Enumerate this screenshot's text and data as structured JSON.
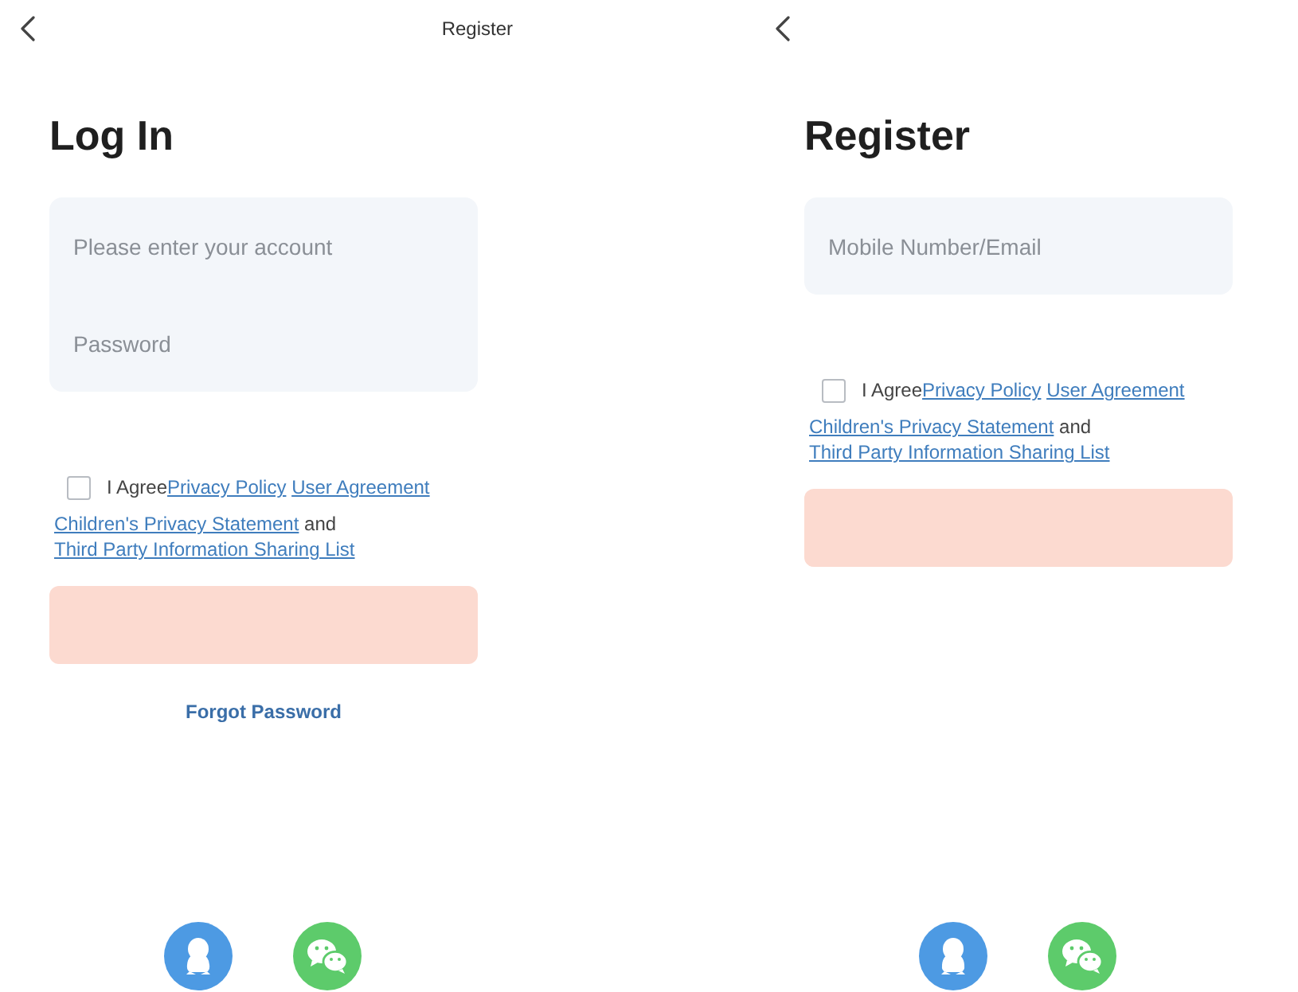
{
  "screens": [
    {
      "header_link": "Register",
      "title": "Log In",
      "fields": [
        {
          "placeholder": "Please enter your account"
        },
        {
          "placeholder": "Password"
        }
      ],
      "agreement": {
        "checked": false,
        "lines": [
          [
            {
              "kind": "text",
              "text": "I Agree"
            },
            {
              "kind": "link",
              "text": "Privacy Policy"
            },
            {
              "kind": "link",
              "text": "User Agreement"
            }
          ],
          [
            {
              "kind": "link",
              "text": "Children's Privacy Statement"
            },
            {
              "kind": "text",
              "text": "and"
            }
          ],
          [
            {
              "kind": "link",
              "text": "Third Party Information Sharing List"
            }
          ]
        ]
      },
      "submit": {
        "disabled": true
      },
      "footer_link": "Forgot Password"
    },
    {
      "title": "Register",
      "fields": [
        {
          "placeholder": "Mobile Number/Email"
        }
      ],
      "agreement": {
        "checked": false,
        "lines": [
          [
            {
              "kind": "text",
              "text": "I Agree"
            },
            {
              "kind": "link",
              "text": "Privacy Policy"
            },
            {
              "kind": "link",
              "text": "User Agreement"
            }
          ],
          [
            {
              "kind": "link",
              "text": "Children's Privacy Statement"
            },
            {
              "kind": "text",
              "text": "and"
            }
          ],
          [
            {
              "kind": "link",
              "text": "Third Party Information Sharing List"
            }
          ]
        ]
      },
      "submit": {
        "disabled": true
      }
    }
  ]
}
